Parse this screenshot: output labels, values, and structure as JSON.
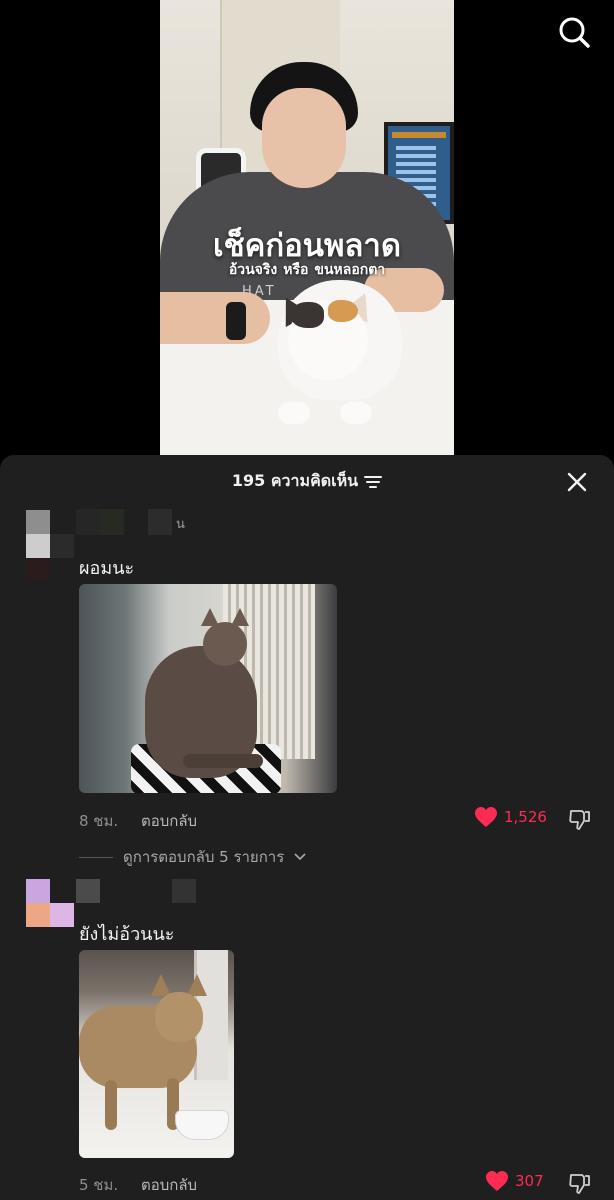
{
  "video": {
    "title": "เช็คก่อนพลาด",
    "subtitle_part1": "อ้วนจริง",
    "subtitle_part2": "หรือ",
    "subtitle_part3": "ขนหลอกตา",
    "shirt_text": "HAT"
  },
  "top_bar": {
    "search_icon": "search-icon"
  },
  "comments_sheet": {
    "header_count_label": "195 ความคิดเห็น",
    "filter_icon": "filter-icon",
    "close_icon": "close-icon"
  },
  "comments": [
    {
      "username": "น",
      "text": "ผอมนะ",
      "time": "8 ชม.",
      "reply_label": "ตอบกลับ",
      "likes": "1,526",
      "view_replies_label": "ดูการตอบกลับ 5 รายการ"
    },
    {
      "username": "",
      "text": "ยังไม่อ้วนนะ",
      "time": "5 ชม.",
      "reply_label": "ตอบกลับ",
      "likes": "307"
    }
  ],
  "colors": {
    "accent_like": "#fe2c55",
    "sheet_bg": "#1f1f1f",
    "page_bg": "#000000"
  }
}
